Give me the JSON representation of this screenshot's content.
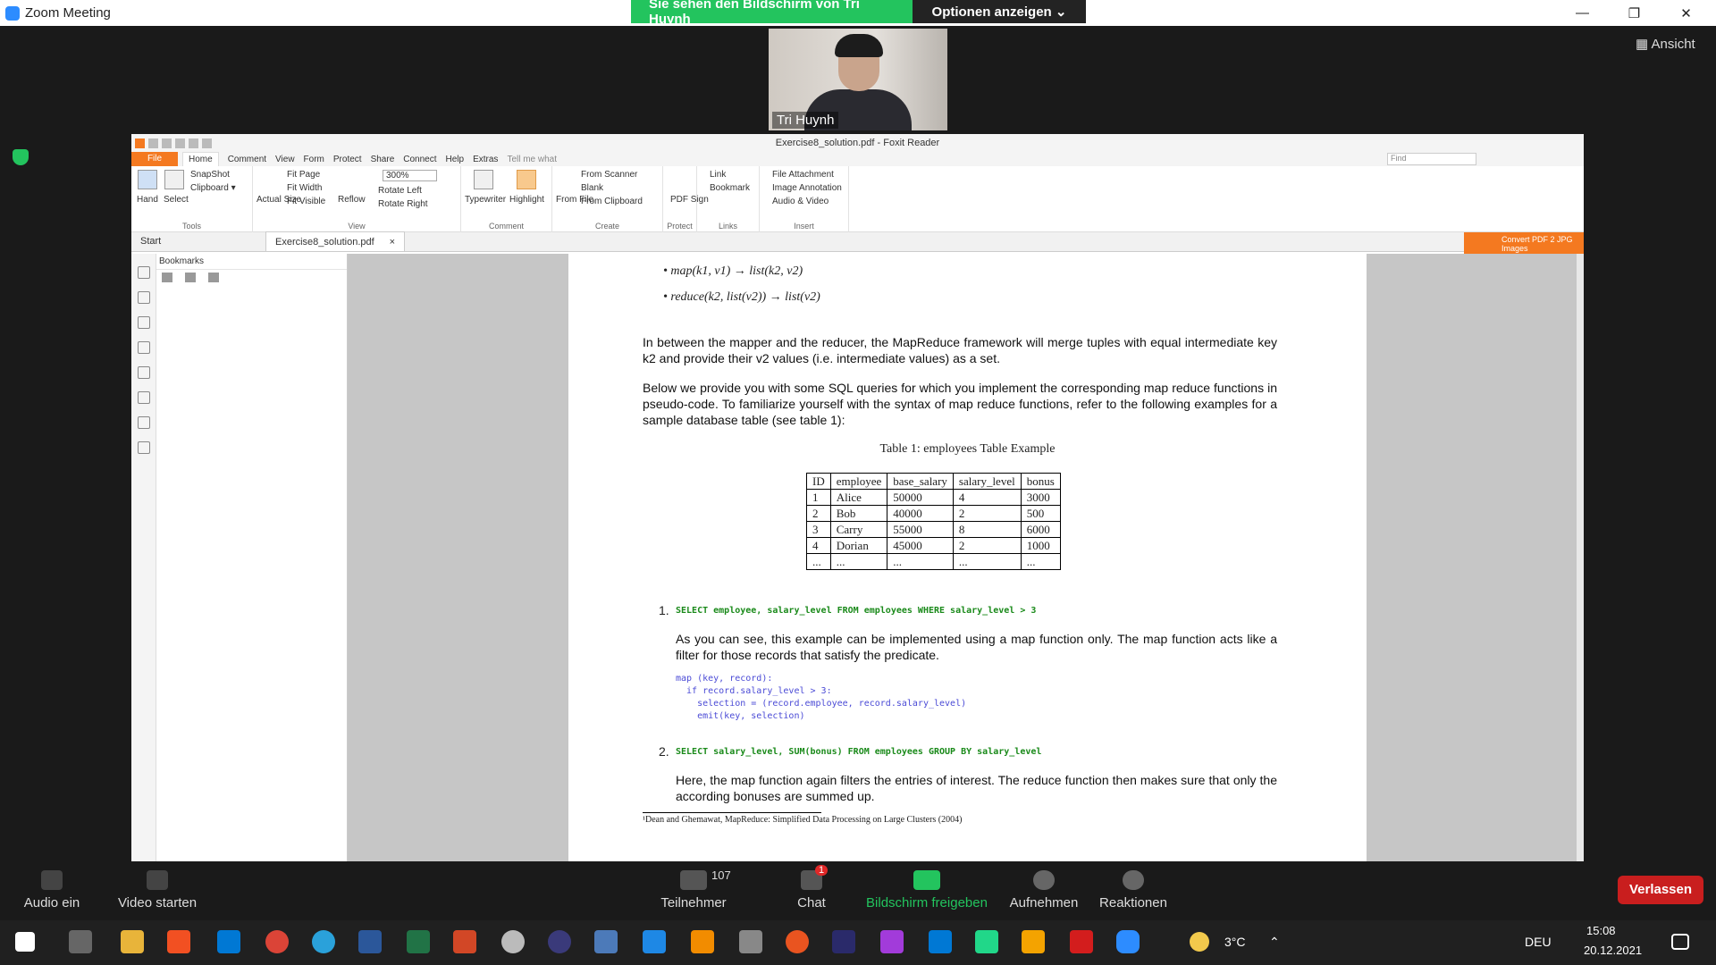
{
  "window": {
    "title": "Zoom Meeting",
    "minimize": "—",
    "restore": "❐",
    "close": "✕"
  },
  "share_banner": {
    "status": "Sie sehen den Bildschirm von Tri Huynh",
    "options": "Optionen anzeigen ⌄"
  },
  "view_button": "Ansicht",
  "participant": {
    "name": "Tri Huynh"
  },
  "foxit": {
    "title": "Exercise8_solution.pdf - Foxit Reader",
    "menu": [
      "File",
      "Home",
      "Comment",
      "View",
      "Form",
      "Protect",
      "Share",
      "Connect",
      "Help",
      "Extras",
      "Tell me what"
    ],
    "find_placeholder": "Find",
    "ribbon": {
      "tools": [
        "Hand",
        "Select",
        "SnapShot",
        "Clipboard ▾"
      ],
      "view": [
        "Actual Size",
        "Fit Page",
        "Fit Width",
        "Fit Visible",
        "Reflow",
        "300%",
        "Rotate Left",
        "Rotate Right"
      ],
      "comment": [
        "Typewriter",
        "Highlight"
      ],
      "create": [
        "From File",
        "From Scanner",
        "Blank",
        "From Clipboard"
      ],
      "protect": [
        "PDF Sign"
      ],
      "links": [
        "Link",
        "Bookmark"
      ],
      "insert": [
        "File Attachment",
        "Image Annotation",
        "Audio & Video"
      ],
      "group_labels": [
        "Tools",
        "View",
        "Comment",
        "Create",
        "Protect",
        "Links",
        "Insert"
      ]
    },
    "tabs": [
      "Start",
      "Exercise8_solution.pdf",
      "×"
    ],
    "convert_banner": "Convert PDF 2 JPG Images",
    "bookmarks_label": "Bookmarks"
  },
  "document": {
    "bullets": [
      "map(k1, v1) → list(k2, v2)",
      "reduce(k2, list(v2)) → list(v2)"
    ],
    "para1": "In between the mapper and the reducer, the MapReduce framework will merge tuples with equal intermediate key k2 and provide their v2 values (i.e. intermediate values) as a set.",
    "para2": "Below we provide you with some SQL queries for which you implement the corresponding map reduce functions in pseudo-code. To familiarize yourself with the syntax of map reduce functions, refer to the following examples for a sample database table (see table 1):",
    "table_caption": "Table 1: employees Table Example",
    "table": {
      "headers": [
        "ID",
        "employee",
        "base_salary",
        "salary_level",
        "bonus"
      ],
      "rows": [
        [
          "1",
          "Alice",
          "50000",
          "4",
          "3000"
        ],
        [
          "2",
          "Bob",
          "40000",
          "2",
          "500"
        ],
        [
          "3",
          "Carry",
          "55000",
          "8",
          "6000"
        ],
        [
          "4",
          "Dorian",
          "45000",
          "2",
          "1000"
        ],
        [
          "...",
          "...",
          "...",
          "...",
          "..."
        ]
      ]
    },
    "q1_num": "1.",
    "q1": "SELECT employee, salary_level FROM employees WHERE salary_level > 3",
    "q1_text": "As you can see, this example can be implemented using a map function only. The map function acts like a filter for those records that satisfy the predicate.",
    "code": [
      "map (key, record):",
      "  if record.salary_level > 3:",
      "    selection = (record.employee, record.salary_level)",
      "    emit(key, selection)"
    ],
    "q2_num": "2.",
    "q2": "SELECT salary_level, SUM(bonus) FROM employees GROUP BY salary_level",
    "q2_text": "Here, the map function again filters the entries of interest. The reduce function then makes sure that only the according bonuses are summed up.",
    "footnote": "¹Dean and Ghemawat, MapReduce: Simplified Data Processing on Large Clusters (2004)"
  },
  "zoom_controls": {
    "audio": "Audio ein",
    "video": "Video starten",
    "participants": "Teilnehmer",
    "participant_count": "107",
    "chat": "Chat",
    "chat_badge": "1",
    "share": "Bildschirm freigeben",
    "record": "Aufnehmen",
    "reactions": "Reaktionen",
    "leave": "Verlassen"
  },
  "taskbar": {
    "weather": "3°C",
    "lang": "DEU",
    "time": "15:08",
    "date": "20.12.2021"
  }
}
